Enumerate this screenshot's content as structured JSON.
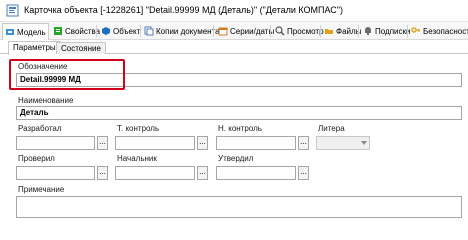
{
  "window": {
    "title": "Карточка объекта [-1228261] \"Detail.99999 МД (Деталь)\" (\"Детали КОМПАС\")"
  },
  "toolbar": {
    "items": [
      {
        "label": "Модель",
        "icon": "model-icon",
        "color": "#3a8fd6"
      },
      {
        "label": "Свойства",
        "icon": "properties-icon",
        "color": "#2aa52a"
      },
      {
        "label": "Объект",
        "icon": "object-icon",
        "color": "#1e6fbf"
      },
      {
        "label": "Копии документа",
        "icon": "copies-icon",
        "color": "#5b7db8"
      },
      {
        "label": "Серии/даты",
        "icon": "series-icon",
        "color": "#d47a1f"
      },
      {
        "label": "Просмотр",
        "icon": "view-icon",
        "color": "#555555"
      },
      {
        "label": "Файлы",
        "icon": "files-icon",
        "color": "#e3a21a"
      },
      {
        "label": "Подписки",
        "icon": "subscriptions-icon",
        "color": "#6c6c6c"
      },
      {
        "label": "Безопасность",
        "icon": "security-icon",
        "color": "#e3a21a"
      }
    ]
  },
  "tabs": [
    {
      "label": "Параметры",
      "active": true
    },
    {
      "label": "Состояние",
      "active": false
    }
  ],
  "form": {
    "designation": {
      "label": "Обозначение",
      "value": "Detail.99999 МД"
    },
    "name": {
      "label": "Наименование",
      "value": "Деталь"
    },
    "developed": {
      "label": "Разработал",
      "value": "",
      "button": "..."
    },
    "tcontrol": {
      "label": "Т. контроль",
      "value": "",
      "button": "..."
    },
    "ncontrol": {
      "label": "Н. контроль",
      "value": "",
      "button": "..."
    },
    "litera": {
      "label": "Литера",
      "value": ""
    },
    "checked": {
      "label": "Проверил",
      "value": "",
      "button": "..."
    },
    "chief": {
      "label": "Начальник",
      "value": "",
      "button": "..."
    },
    "approved": {
      "label": "Утвердил",
      "value": "",
      "button": "..."
    },
    "note": {
      "label": "Примечание",
      "value": ""
    }
  },
  "colors": {
    "highlight": "#d0021b",
    "field_border": "#a6a6a6"
  }
}
